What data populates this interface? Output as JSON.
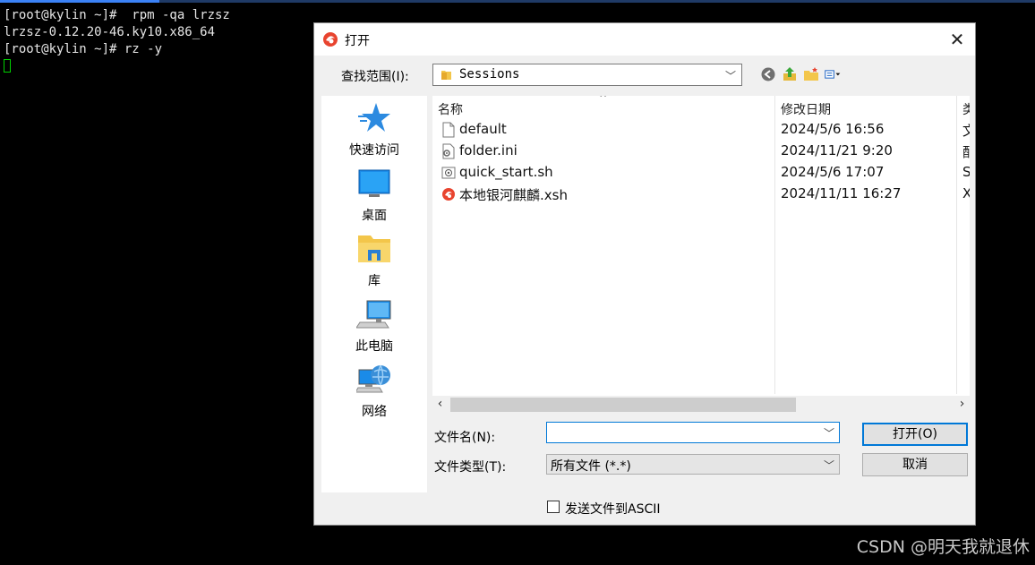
{
  "terminal": {
    "lines": [
      "[root@kylin ~]#  rpm -qa lrzsz",
      "lrzsz-0.12.20-46.ky10.x86_64",
      "[root@kylin ~]# rz -y"
    ]
  },
  "dialog": {
    "title": "打开",
    "look_in_label": "查找范围(I):",
    "look_in_value": "Sessions",
    "places": [
      {
        "label": "快速访问",
        "icon": "star-icon"
      },
      {
        "label": "桌面",
        "icon": "desktop-icon"
      },
      {
        "label": "库",
        "icon": "library-icon"
      },
      {
        "label": "此电脑",
        "icon": "computer-icon"
      },
      {
        "label": "网络",
        "icon": "network-icon"
      }
    ],
    "columns": {
      "name": "名称",
      "date": "修改日期",
      "type": "类"
    },
    "files": [
      {
        "name": "default",
        "date": "2024/5/6 16:56",
        "type": "文",
        "icon": "blank-file-icon"
      },
      {
        "name": "folder.ini",
        "date": "2024/11/21 9:20",
        "type": "配",
        "icon": "settings-file-icon"
      },
      {
        "name": "quick_start.sh",
        "date": "2024/5/6 17:07",
        "type": "S",
        "icon": "script-file-icon"
      },
      {
        "name": "本地银河麒麟.xsh",
        "date": "2024/11/11 16:27",
        "type": "X",
        "icon": "xshell-file-icon"
      }
    ],
    "filename_label": "文件名(N):",
    "filename_value": "",
    "filetype_label": "文件类型(T):",
    "filetype_value": "所有文件 (*.*)",
    "open_button": "打开(O)",
    "cancel_button": "取消",
    "ascii_label": "发送文件到ASCII",
    "ascii_checked": false
  },
  "watermark": "CSDN @明天我就退休",
  "colors": {
    "accent": "#0078d7",
    "terminal_bg": "#000000",
    "cursor": "#00d000"
  }
}
